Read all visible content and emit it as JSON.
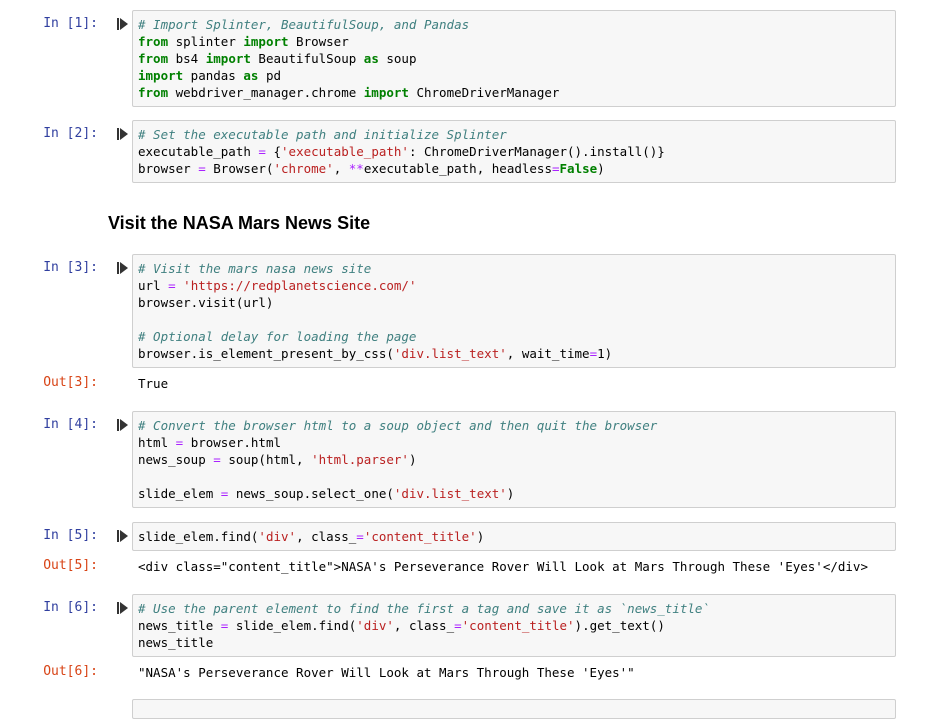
{
  "cells": [
    {
      "prompt": "In [1]:",
      "lines": [
        [
          [
            "c",
            "# Import Splinter, BeautifulSoup, and Pandas"
          ]
        ],
        [
          [
            "k",
            "from"
          ],
          [
            "n",
            " splinter "
          ],
          [
            "k",
            "import"
          ],
          [
            "n",
            " Browser"
          ]
        ],
        [
          [
            "k",
            "from"
          ],
          [
            "n",
            " bs4 "
          ],
          [
            "k",
            "import"
          ],
          [
            "n",
            " BeautifulSoup "
          ],
          [
            "k",
            "as"
          ],
          [
            "n",
            " soup"
          ]
        ],
        [
          [
            "k",
            "import"
          ],
          [
            "n",
            " pandas "
          ],
          [
            "k",
            "as"
          ],
          [
            "n",
            " pd"
          ]
        ],
        [
          [
            "k",
            "from"
          ],
          [
            "n",
            " webdriver_manager.chrome "
          ],
          [
            "k",
            "import"
          ],
          [
            "n",
            " ChromeDriverManager"
          ]
        ]
      ]
    },
    {
      "prompt": "In [2]:",
      "lines": [
        [
          [
            "c",
            "# Set the executable path and initialize Splinter"
          ]
        ],
        [
          [
            "n",
            "executable_path "
          ],
          [
            "o",
            "="
          ],
          [
            "n",
            " {"
          ],
          [
            "s",
            "'executable_path'"
          ],
          [
            "n",
            ": ChromeDriverManager().install()}"
          ]
        ],
        [
          [
            "n",
            "browser "
          ],
          [
            "o",
            "="
          ],
          [
            "n",
            " Browser("
          ],
          [
            "s",
            "'chrome'"
          ],
          [
            "n",
            ", "
          ],
          [
            "o",
            "**"
          ],
          [
            "n",
            "executable_path, headless"
          ],
          [
            "o",
            "="
          ],
          [
            "k",
            "False"
          ],
          [
            "n",
            ")"
          ]
        ]
      ]
    },
    {
      "prompt": "In [3]:",
      "lines": [
        [
          [
            "c",
            "# Visit the mars nasa news site"
          ]
        ],
        [
          [
            "n",
            "url "
          ],
          [
            "o",
            "="
          ],
          [
            "n",
            " "
          ],
          [
            "s",
            "'https://redplanetscience.com/'"
          ]
        ],
        [
          [
            "n",
            "browser.visit(url)"
          ]
        ],
        [
          [
            "n",
            ""
          ]
        ],
        [
          [
            "c",
            "# Optional delay for loading the page"
          ]
        ],
        [
          [
            "n",
            "browser.is_element_present_by_css("
          ],
          [
            "s",
            "'div.list_text'"
          ],
          [
            "n",
            ", wait_time"
          ],
          [
            "o",
            "="
          ],
          [
            "n",
            "1)"
          ]
        ]
      ]
    },
    {
      "prompt": "In [4]:",
      "lines": [
        [
          [
            "c",
            "# Convert the browser html to a soup object and then quit the browser"
          ]
        ],
        [
          [
            "n",
            "html "
          ],
          [
            "o",
            "="
          ],
          [
            "n",
            " browser.html"
          ]
        ],
        [
          [
            "n",
            "news_soup "
          ],
          [
            "o",
            "="
          ],
          [
            "n",
            " soup(html, "
          ],
          [
            "s",
            "'html.parser'"
          ],
          [
            "n",
            ")"
          ]
        ],
        [
          [
            "n",
            ""
          ]
        ],
        [
          [
            "n",
            "slide_elem "
          ],
          [
            "o",
            "="
          ],
          [
            "n",
            " news_soup.select_one("
          ],
          [
            "s",
            "'div.list_text'"
          ],
          [
            "n",
            ")"
          ]
        ]
      ]
    },
    {
      "prompt": "In [5]:",
      "lines": [
        [
          [
            "n",
            "slide_elem.find("
          ],
          [
            "s",
            "'div'"
          ],
          [
            "n",
            ", class_"
          ],
          [
            "o",
            "="
          ],
          [
            "s",
            "'content_title'"
          ],
          [
            "n",
            ")"
          ]
        ]
      ]
    },
    {
      "prompt": "In [6]:",
      "lines": [
        [
          [
            "c",
            "# Use the parent element to find the first a tag and save it as `news_title`"
          ]
        ],
        [
          [
            "n",
            "news_title "
          ],
          [
            "o",
            "="
          ],
          [
            "n",
            " slide_elem.find("
          ],
          [
            "s",
            "'div'"
          ],
          [
            "n",
            ", class_"
          ],
          [
            "o",
            "="
          ],
          [
            "s",
            "'content_title'"
          ],
          [
            "n",
            ").get_text()"
          ]
        ],
        [
          [
            "n",
            "news_title"
          ]
        ]
      ]
    }
  ],
  "outputs": [
    {
      "prompt": "Out[3]:",
      "text": "True"
    },
    {
      "prompt": "Out[5]:",
      "text": "<div class=\"content_title\">NASA's Perseverance Rover Will Look at Mars Through These 'Eyes'</div>"
    },
    {
      "prompt": "Out[6]:",
      "text": "\"NASA's Perseverance Rover Will Look at Mars Through These 'Eyes'\""
    }
  ],
  "markdown": {
    "heading": "Visit the NASA Mars News Site"
  },
  "colors": {
    "in_prompt": "#303f9f",
    "out_prompt": "#d84315",
    "comment": "#408080",
    "keyword": "#008000",
    "string": "#ba2121",
    "operator": "#aa22ff"
  },
  "icons": {
    "run": "run-cell-icon"
  }
}
